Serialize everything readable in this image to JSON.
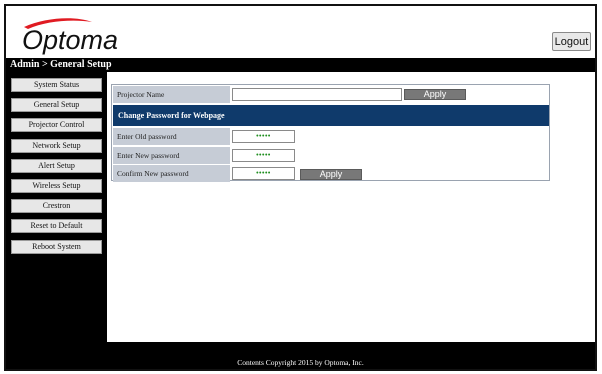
{
  "header": {
    "logo_text": "Optoma",
    "logout_label": "Logout"
  },
  "breadcrumb": "Admin > General Setup",
  "sidebar": {
    "items": [
      {
        "label": "System Status"
      },
      {
        "label": "General Setup"
      },
      {
        "label": "Projector Control"
      },
      {
        "label": "Network Setup"
      },
      {
        "label": "Alert Setup"
      },
      {
        "label": "Wireless Setup"
      },
      {
        "label": "Crestron"
      },
      {
        "label": "Reset to Default"
      },
      {
        "label": "Reboot System"
      }
    ]
  },
  "form": {
    "projector_name_label": "Projector Name",
    "projector_name_value": "",
    "apply_label": "Apply",
    "section_title": "Change Password for Webpage",
    "old_password_label": "Enter Old password",
    "old_password_value": "•••••",
    "new_password_label": "Enter New password",
    "new_password_value": "•••••",
    "confirm_password_label": "Confirm New password",
    "confirm_password_value": "•••••",
    "password_apply_label": "Apply"
  },
  "footer": {
    "copyright": "Contents Copyright 2015 by Optoma, Inc."
  },
  "colors": {
    "brand_red": "#e01b22",
    "section_header": "#0f3a6b",
    "label_bg": "#c6ccd6",
    "password_dots": "#1f8f1f"
  }
}
